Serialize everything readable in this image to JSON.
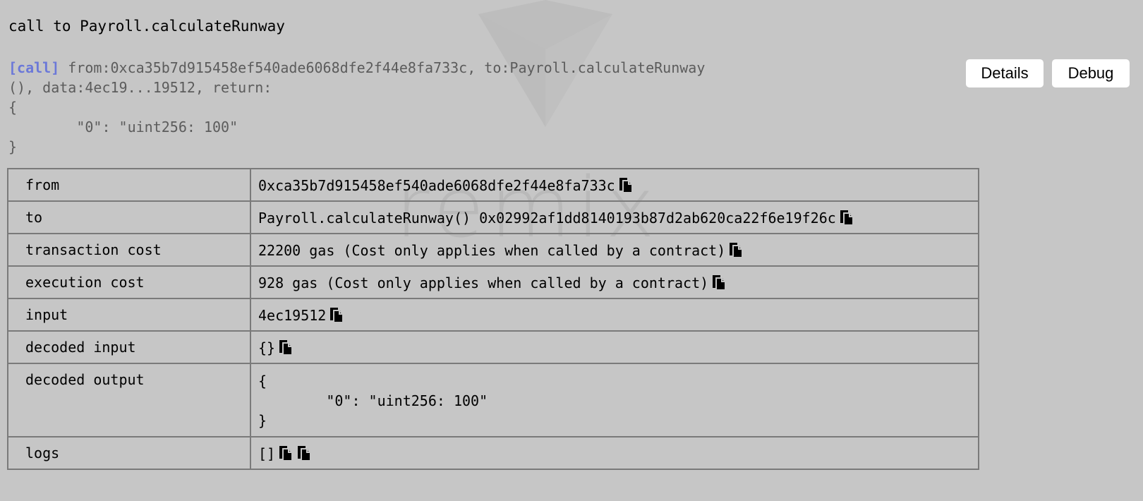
{
  "title": "call to Payroll.calculateRunway",
  "summary": {
    "tag": "[call]",
    "line1": " from:0xca35b7d915458ef540ade6068dfe2f44e8fa733c, to:Payroll.calculateRunway",
    "line2": "(), data:4ec19...19512, return:",
    "line3": "{",
    "line4": "        \"0\": \"uint256: 100\"",
    "line5": "}"
  },
  "buttons": {
    "details": "Details",
    "debug": "Debug"
  },
  "watermark": "remix",
  "rows": [
    {
      "key": "from",
      "value": "0xca35b7d915458ef540ade6068dfe2f44e8fa733c"
    },
    {
      "key": "to",
      "value": "Payroll.calculateRunway() 0x02992af1dd8140193b87d2ab620ca22f6e19f26c"
    },
    {
      "key": "transaction cost",
      "value": "22200 gas (Cost only applies when called by a contract)"
    },
    {
      "key": "execution cost",
      "value": "928 gas (Cost only applies when called by a contract)"
    },
    {
      "key": "input",
      "value": "4ec19512"
    },
    {
      "key": "decoded input",
      "value": "{}"
    },
    {
      "key": "decoded output",
      "value": "{\n        \"0\": \"uint256: 100\"\n}"
    },
    {
      "key": "logs",
      "value": "[]"
    }
  ],
  "icons": {
    "copy": "copy-icon"
  },
  "colors": {
    "background": "#c6c6c6",
    "tag": "#6b78d8",
    "summary_text": "#5c5c5c",
    "border": "#7a7a7a"
  }
}
